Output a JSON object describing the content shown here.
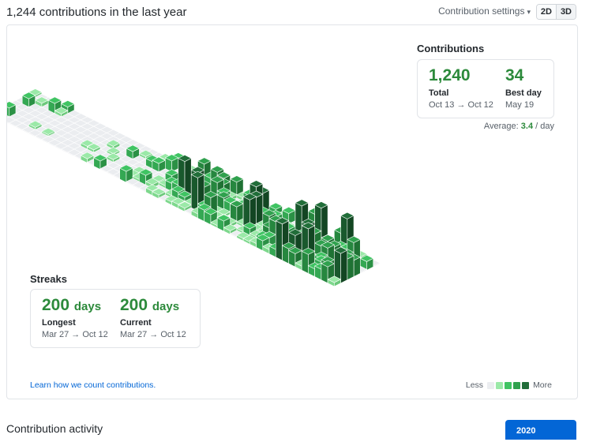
{
  "header": {
    "title": "1,244 contributions in the last year",
    "settings_label": "Contribution settings",
    "view_toggle": [
      "2D",
      "3D"
    ]
  },
  "contributions": {
    "heading": "Contributions",
    "total": {
      "value": "1,240",
      "label": "Total",
      "range": "Oct 13 → Oct 12"
    },
    "best_day": {
      "value": "34",
      "label": "Best day",
      "date": "May 19"
    },
    "average": {
      "prefix": "Average:",
      "value": "3.4",
      "suffix": "/ day"
    }
  },
  "streaks": {
    "heading": "Streaks",
    "longest": {
      "value": "200",
      "unit": "days",
      "label": "Longest",
      "range": "Mar 27 → Oct 12"
    },
    "current": {
      "value": "200",
      "unit": "days",
      "label": "Current",
      "range": "Mar 27 → Oct 12"
    }
  },
  "footer": {
    "learn_link": "Learn how we count contributions.",
    "legend_less": "Less",
    "legend_more": "More",
    "legend_colors": [
      "#ebedf0",
      "#9be9a8",
      "#40c463",
      "#30a14e",
      "#216e39"
    ]
  },
  "activity": {
    "title": "Contribution activity",
    "year": "2020"
  },
  "colors": {
    "accent": "#0366d6",
    "green": "#2c8a3b"
  }
}
